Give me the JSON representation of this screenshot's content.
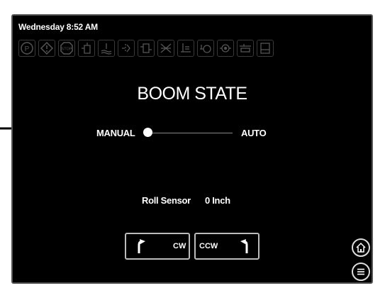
{
  "status": {
    "datetime": "Wednesday 8:52 AM"
  },
  "icon_bar": [
    "parking-brake-icon",
    "warning-icon",
    "stop-icon",
    "boom-icon",
    "water-level-icon",
    "sensor-icon",
    "filter-icon",
    "fan-icon",
    "leveler-icon",
    "hydraulic-icon",
    "oil-pressure-icon",
    "pump-icon",
    "tank-icon"
  ],
  "icon_labels": {
    "parking": "P",
    "stop": "STOP"
  },
  "main": {
    "title": "BOOM STATE",
    "mode_left": "MANUAL",
    "mode_right": "AUTO",
    "roll_label": "Roll Sensor",
    "roll_value": "0 Inch"
  },
  "controls": {
    "cw_label": "CW",
    "ccw_label": "CCW"
  },
  "nav": {
    "home": "home-icon",
    "menu": "menu-icon"
  },
  "colors": {
    "background": "#000000",
    "text": "#ffffff",
    "icon_dim": "#555555"
  }
}
